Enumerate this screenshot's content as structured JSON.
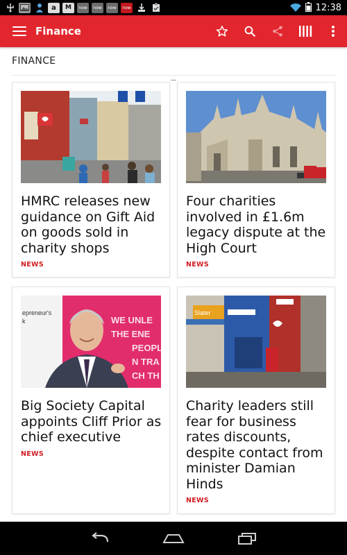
{
  "status_bar": {
    "time": "12:38",
    "notification_icons": [
      "usb-icon",
      "image-icon",
      "person-icon",
      "amazon-icon",
      "mail-icon",
      "news-icon",
      "news-icon",
      "news-icon",
      "news-red-icon",
      "download-icon",
      "clipboard-icon"
    ],
    "icon_text": {
      "amazon": "a",
      "mail": "M",
      "news": "now"
    }
  },
  "toolbar": {
    "title": "Finance",
    "accent_color": "#e2262d",
    "actions": [
      "star-icon",
      "search-icon",
      "share-icon",
      "columns-icon",
      "more-vert-icon"
    ]
  },
  "section": {
    "title": "FINANCE"
  },
  "articles": [
    {
      "title": "HMRC releases new guidance on Gift Aid on goods sold in charity shops",
      "tag": "NEWS",
      "image": "charity-shops-street-photo"
    },
    {
      "title": "Four charities involved in £1.6m legacy dispute at the High Court",
      "tag": "NEWS",
      "image": "royal-courts-of-justice-photo"
    },
    {
      "title": "Big Society Capital appoints Cliff Prior as chief executive",
      "tag": "NEWS",
      "image": "cliff-prior-portrait-photo"
    },
    {
      "title": "Charity leaders still fear for business rates discounts, despite contact from minister Damian Hinds",
      "tag": "NEWS",
      "image": "high-street-shopfronts-photo"
    }
  ],
  "nav_bar": {
    "buttons": [
      "back-icon",
      "home-icon",
      "recents-icon"
    ]
  }
}
